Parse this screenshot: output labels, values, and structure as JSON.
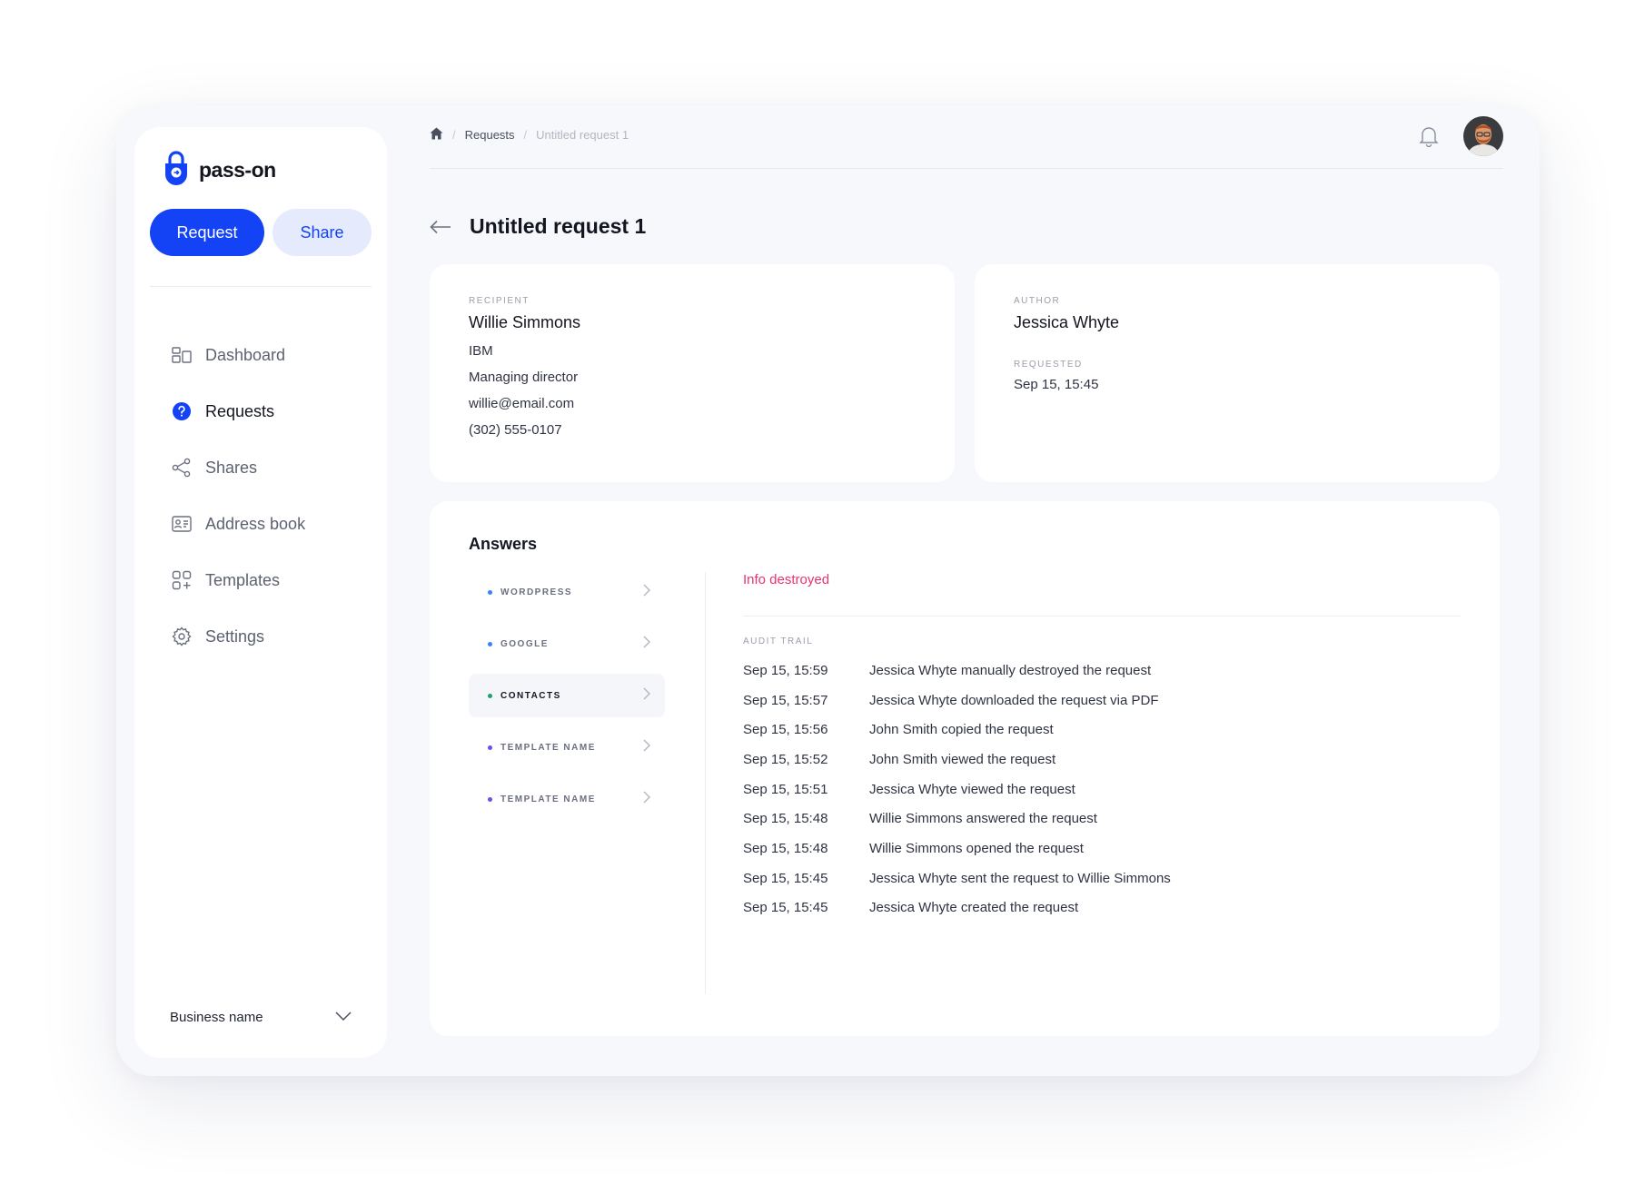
{
  "brand": {
    "name": "pass-on",
    "accent": "#1343f5"
  },
  "actions": {
    "request_label": "Request",
    "share_label": "Share"
  },
  "nav": {
    "items": [
      {
        "label": "Dashboard",
        "icon": "dashboard-icon",
        "active": false
      },
      {
        "label": "Requests",
        "icon": "question-circle-icon",
        "active": true
      },
      {
        "label": "Shares",
        "icon": "share-icon",
        "active": false
      },
      {
        "label": "Address book",
        "icon": "contact-card-icon",
        "active": false
      },
      {
        "label": "Templates",
        "icon": "templates-icon",
        "active": false
      },
      {
        "label": "Settings",
        "icon": "gear-icon",
        "active": false
      }
    ]
  },
  "business": {
    "label": "Business name"
  },
  "breadcrumb": {
    "home_icon": "home-icon",
    "items": [
      "Requests",
      "Untitled request 1"
    ]
  },
  "page": {
    "title": "Untitled request 1"
  },
  "recipient": {
    "label": "RECIPIENT",
    "name": "Willie Simmons",
    "company": "IBM",
    "role": "Managing director",
    "email": "willie@email.com",
    "phone": "(302) 555-0107"
  },
  "author": {
    "label": "AUTHOR",
    "name": "Jessica Whyte",
    "requested_label": "REQUESTED",
    "requested_value": "Sep 15, 15:45"
  },
  "answers": {
    "title": "Answers",
    "items": [
      {
        "label": "WORDPRESS",
        "dot_color": "#3b82f6",
        "active": false
      },
      {
        "label": "GOOGLE",
        "dot_color": "#3b82f6",
        "active": false
      },
      {
        "label": "CONTACTS",
        "dot_color": "#22a06b",
        "active": true
      },
      {
        "label": "TEMPLATE NAME",
        "dot_color": "#6d4ee8",
        "active": false
      },
      {
        "label": "TEMPLATE NAME",
        "dot_color": "#6d4ee8",
        "active": false
      }
    ],
    "status": "Info destroyed",
    "status_color": "#e8336f",
    "audit_label": "AUDIT TRAIL",
    "audit": [
      {
        "time": "Sep 15, 15:59",
        "text": "Jessica Whyte manually destroyed the request"
      },
      {
        "time": "Sep 15, 15:57",
        "text": "Jessica Whyte downloaded the request via PDF"
      },
      {
        "time": "Sep 15, 15:56",
        "text": "John Smith copied the request"
      },
      {
        "time": "Sep 15, 15:52",
        "text": "John Smith viewed the request"
      },
      {
        "time": "Sep 15, 15:51",
        "text": "Jessica Whyte viewed the request"
      },
      {
        "time": "Sep 15, 15:48",
        "text": "Willie Simmons answered the request"
      },
      {
        "time": "Sep 15, 15:48",
        "text": "Willie Simmons opened the request"
      },
      {
        "time": "Sep 15, 15:45",
        "text": "Jessica Whyte sent the request to Willie Simmons"
      },
      {
        "time": "Sep 15, 15:45",
        "text": "Jessica Whyte created the request"
      }
    ]
  }
}
